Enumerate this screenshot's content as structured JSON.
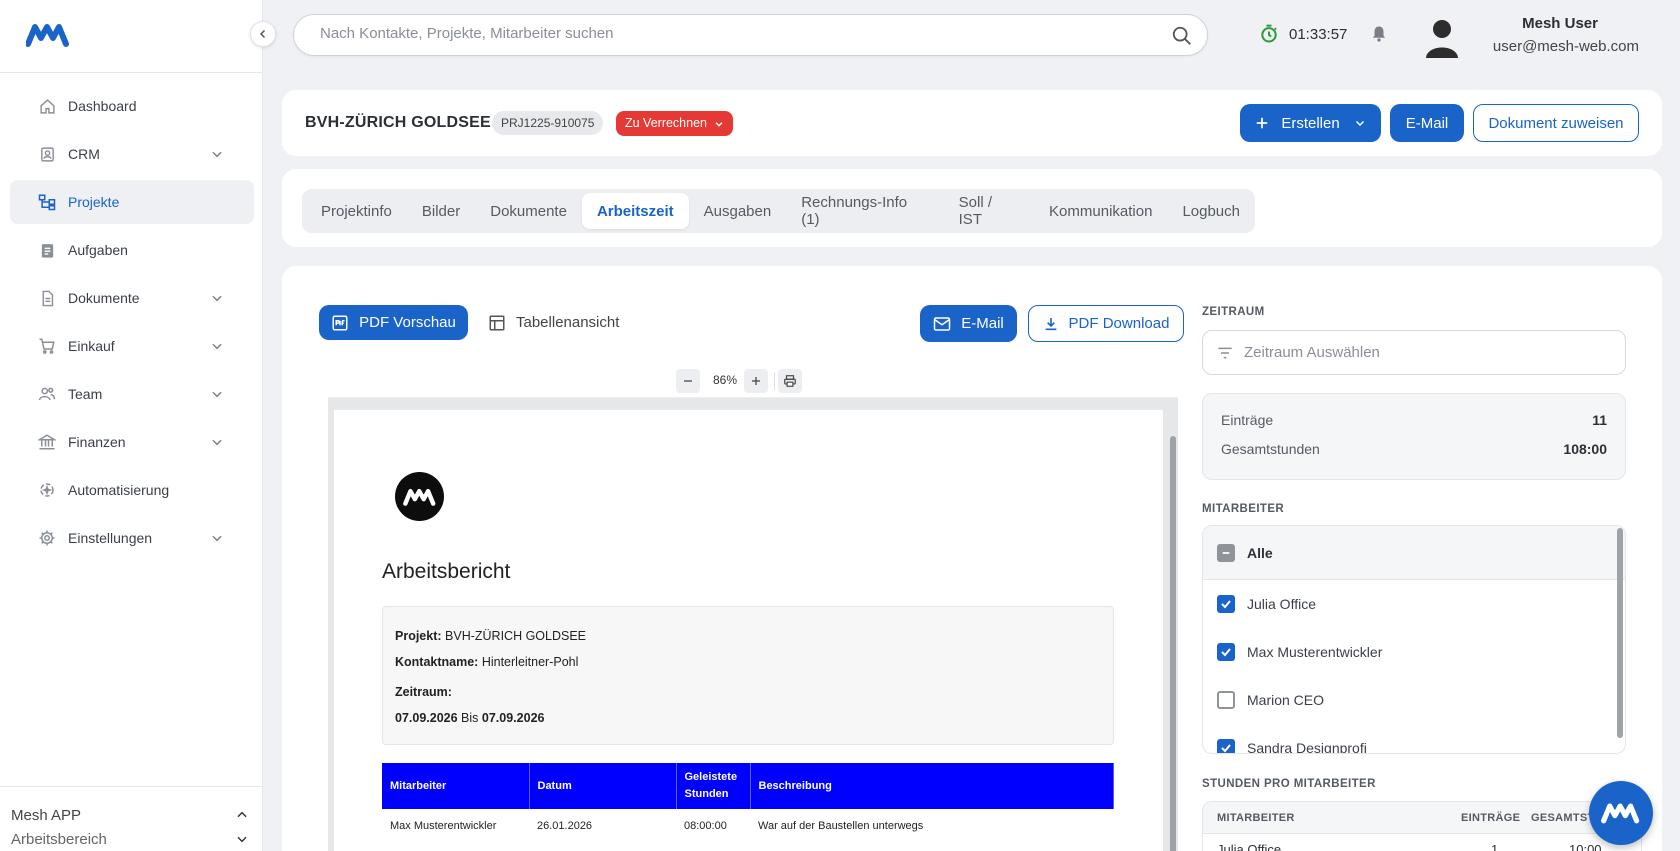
{
  "app": {
    "name": "Mesh",
    "brand_color": "#1a63c9"
  },
  "search": {
    "placeholder": "Nach Kontakte, Projekte, Mitarbeiter suchen"
  },
  "timer": {
    "value": "01:33:57"
  },
  "user": {
    "name": "Mesh User",
    "email": "user@mesh-web.com"
  },
  "sidebar": {
    "items": [
      {
        "label": "Dashboard",
        "icon": "home-icon"
      },
      {
        "label": "CRM",
        "icon": "contacts-icon"
      },
      {
        "label": "Projekte",
        "icon": "project-icon"
      },
      {
        "label": "Aufgaben",
        "icon": "clipboard-icon"
      },
      {
        "label": "Dokumente",
        "icon": "document-icon"
      },
      {
        "label": "Einkauf",
        "icon": "cart-icon"
      },
      {
        "label": "Team",
        "icon": "team-icon"
      },
      {
        "label": "Finanzen",
        "icon": "bank-icon"
      },
      {
        "label": "Automatisierung",
        "icon": "automation-icon"
      },
      {
        "label": "Einstellungen",
        "icon": "gear-icon"
      }
    ],
    "bottom": {
      "app": "Mesh APP",
      "workspace": "Arbeitsbereich"
    }
  },
  "project": {
    "title": "BVH-ZÜRICH GOLDSEE",
    "code": "PRJ1225-910075",
    "status": "Zu Verrechnen",
    "status_color": "#e53935",
    "actions": {
      "create": "Erstellen",
      "email": "E-Mail",
      "assign": "Dokument zuweisen"
    }
  },
  "tabs": [
    "Projektinfo",
    "Bilder",
    "Dokumente",
    "Arbeitszeit",
    "Ausgaben",
    "Rechnungs-Info (1)",
    "Soll / IST",
    "Kommunikation",
    "Logbuch"
  ],
  "toolbar": {
    "pdf_preview": "PDF Vorschau",
    "table_view": "Tabellenansicht",
    "email": "E-Mail",
    "pdf_download": "PDF Download"
  },
  "viewer": {
    "zoom": "86%"
  },
  "report": {
    "title": "Arbeitsbericht",
    "project_label": "Projekt:",
    "project_value": "BVH-ZÜRICH GOLDSEE",
    "contact_label": "Kontaktname:",
    "contact_value": "Hinterleitner-Pohl",
    "period_label": "Zeitraum:",
    "period_from": "07.09.2026",
    "period_to_word": "Bis",
    "period_to": "07.09.2026",
    "table_header_color": "#0000ff",
    "columns": [
      "Mitarbeiter",
      "Datum",
      "Geleistete Stunden",
      "Beschreibung"
    ],
    "rows": [
      [
        "Max Musterentwickler",
        "26.01.2026",
        "08:00:00",
        "War auf der Baustellen unterwegs"
      ]
    ]
  },
  "panel": {
    "zeitraum_label": "ZEITRAUM",
    "zeitraum_placeholder": "Zeitraum Auswählen",
    "entries_label": "Einträge",
    "entries_value": "11",
    "hours_label": "Gesamtstunden",
    "hours_value": "108:00",
    "mitarbeiter_label": "MITARBEITER",
    "all_label": "Alle",
    "employees": [
      {
        "name": "Julia Office",
        "checked": true
      },
      {
        "name": "Max Musterentwickler",
        "checked": true
      },
      {
        "name": "Marion CEO",
        "checked": false
      },
      {
        "name": "Sandra Designprofi",
        "checked": true
      }
    ],
    "spm_label": "STUNDEN PRO MITARBEITER",
    "spm_columns": [
      "MITARBEITER",
      "EINTRÄGE",
      "GESAMTST"
    ],
    "spm_rows": [
      [
        "Julia Office",
        "1",
        "10:00"
      ]
    ]
  }
}
